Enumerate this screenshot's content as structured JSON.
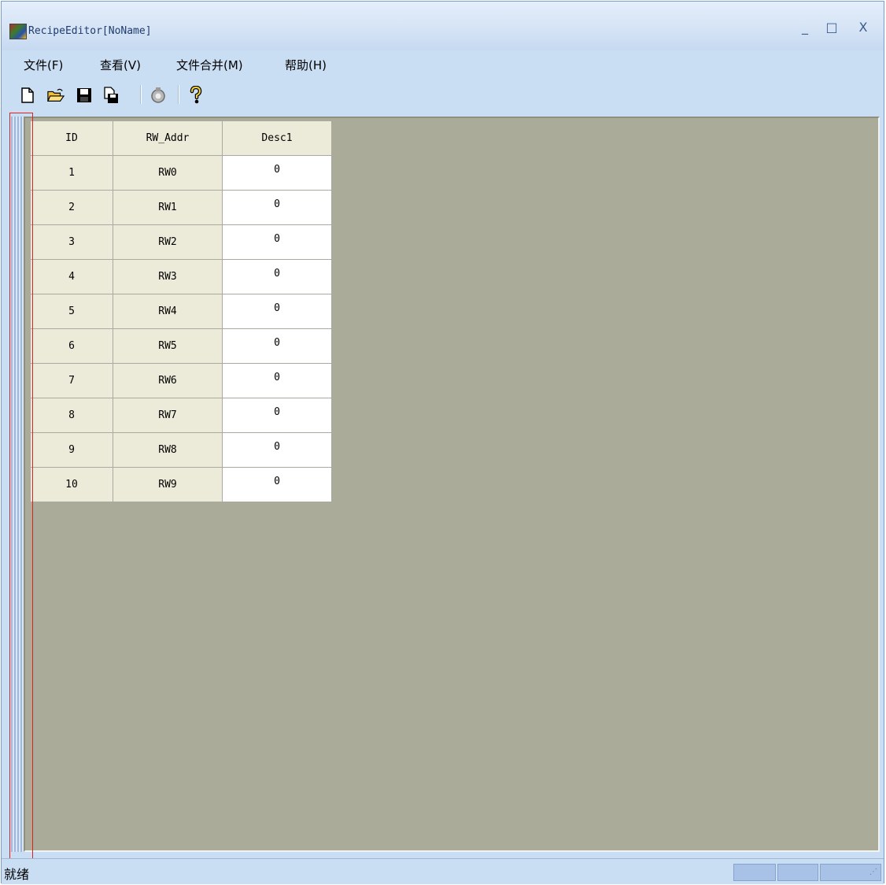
{
  "window": {
    "title": "RecipeEditor[NoName]",
    "minimize_label": "_",
    "maximize_label": "□",
    "close_label": "X"
  },
  "menu": {
    "items": [
      {
        "label": "文件(F)"
      },
      {
        "label": "查看(V)"
      },
      {
        "label": "文件合并(M)"
      },
      {
        "label": "帮助(H)"
      }
    ]
  },
  "toolbar": {
    "icons": [
      "new-file-icon",
      "open-folder-icon",
      "save-icon",
      "save-as-icon",
      "print-icon",
      "help-icon"
    ]
  },
  "table": {
    "headers": [
      "ID",
      "RW_Addr",
      "Desc1"
    ],
    "rows": [
      [
        "1",
        "RW0",
        "0"
      ],
      [
        "2",
        "RW1",
        "0"
      ],
      [
        "3",
        "RW2",
        "0"
      ],
      [
        "4",
        "RW3",
        "0"
      ],
      [
        "5",
        "RW4",
        "0"
      ],
      [
        "6",
        "RW5",
        "0"
      ],
      [
        "7",
        "RW6",
        "0"
      ],
      [
        "8",
        "RW7",
        "0"
      ],
      [
        "9",
        "RW8",
        "0"
      ],
      [
        "10",
        "RW9",
        "0"
      ]
    ]
  },
  "status": {
    "text": "就绪"
  },
  "colors": {
    "frame": "#c9ddf3",
    "client_background": "#aaab99",
    "selection": "#e02020"
  }
}
